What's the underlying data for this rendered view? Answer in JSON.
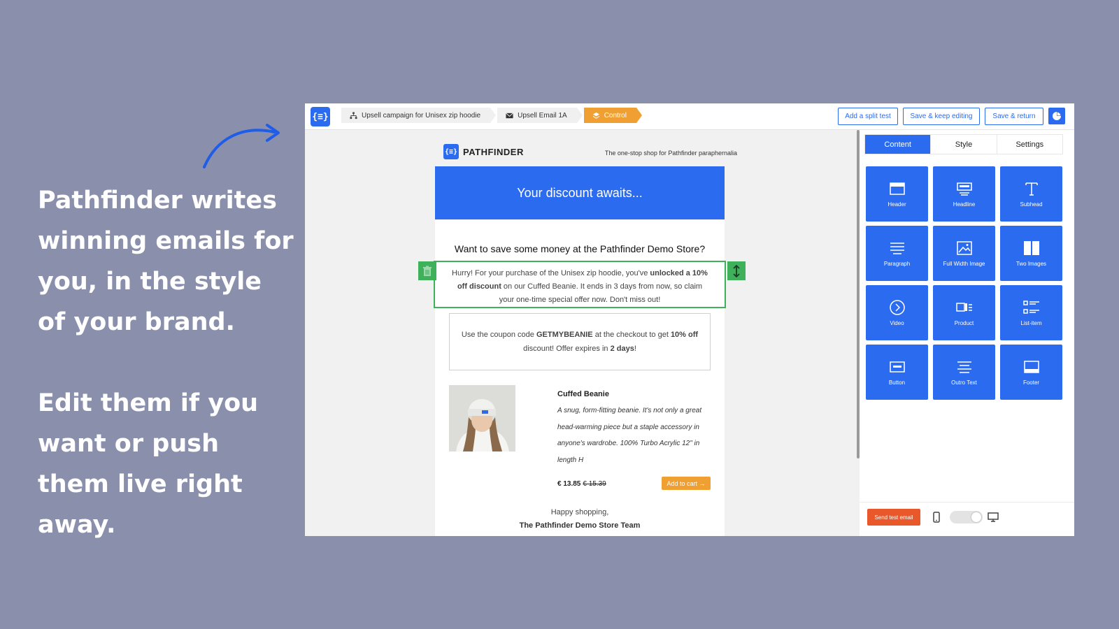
{
  "pitch": {
    "line1": "Pathfinder writes winning emails for you, in the style of your brand.",
    "line2": "Edit them if you want or push them live right away."
  },
  "app": {
    "logo_glyph": "{≡}",
    "breadcrumbs": [
      {
        "label": "Upsell campaign for Unisex zip hoodie",
        "icon": "sitemap-icon"
      },
      {
        "label": "Upsell Email 1A",
        "icon": "envelope-icon"
      },
      {
        "label": "Control",
        "icon": "layers-icon"
      }
    ],
    "actions": {
      "split_test": "Add a split test",
      "save_keep": "Save & keep editing",
      "save_return": "Save & return"
    }
  },
  "email": {
    "brand": "PATHFINDER",
    "tagline": "The one-stop shop for Pathfinder paraphernalia",
    "hero": "Your discount awaits...",
    "question": "Want to save some money at the Pathfinder Demo Store?",
    "body": {
      "p1": "Hurry! For your purchase of the Unisex zip hoodie, you've ",
      "b1": "unlocked a 10% off discount",
      "p2": " on our Cuffed Beanie. It ends in 3 days from now, so claim your one-time special offer now. Don't miss out!"
    },
    "coupon": {
      "p1": "Use the coupon code ",
      "code": "GETMYBEANIE",
      "p2": " at the checkout to get ",
      "b2": "10% off",
      "p3": " discount! Offer expires in ",
      "b3": "2 days",
      "p4": "!"
    },
    "product": {
      "name": "Cuffed Beanie",
      "description": "A snug, form-fitting beanie. It's not only a great head-warming piece but a staple accessory in anyone's wardrobe. 100% Turbo Acrylic 12\" in length H",
      "price": "€ 13.85",
      "old_price": "€ 15.39",
      "cart_label": "Add to cart →"
    },
    "signoff": "Happy shopping,",
    "team": "The Pathfinder Demo Store Team"
  },
  "panel": {
    "tabs": [
      "Content",
      "Style",
      "Settings"
    ],
    "blocks": [
      {
        "label": "Header",
        "icon": "header-block-icon"
      },
      {
        "label": "Headline",
        "icon": "headline-block-icon"
      },
      {
        "label": "Subhead",
        "icon": "text-t-icon"
      },
      {
        "label": "Paragraph",
        "icon": "paragraph-lines-icon"
      },
      {
        "label": "Full Width Image",
        "icon": "image-icon"
      },
      {
        "label": "Two Images",
        "icon": "two-images-icon"
      },
      {
        "label": "Video",
        "icon": "play-circle-icon"
      },
      {
        "label": "Product",
        "icon": "product-icon"
      },
      {
        "label": "List-item",
        "icon": "list-icon"
      },
      {
        "label": "Button",
        "icon": "button-block-icon"
      },
      {
        "label": "Outro Text",
        "icon": "outro-lines-icon"
      },
      {
        "label": "Footer",
        "icon": "footer-block-icon"
      }
    ],
    "send_test": "Send test email"
  },
  "colors": {
    "background": "#8a8fac",
    "brand_blue": "#2b6bef",
    "accent_orange": "#f0a033",
    "selection_green": "#3fb15a",
    "send_red": "#e8582a"
  }
}
